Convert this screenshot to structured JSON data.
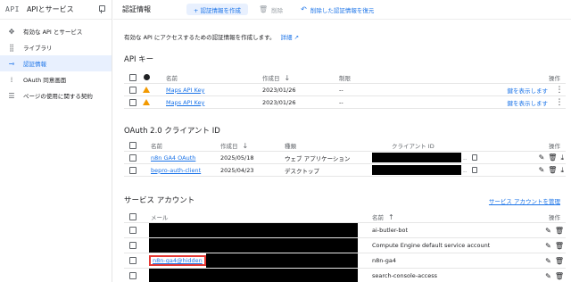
{
  "sidebar": {
    "logo": "API",
    "title": "APIとサービス",
    "items": [
      {
        "label": "有効な API とサービス",
        "icon": "api-services-icon"
      },
      {
        "label": "ライブラリ",
        "icon": "library-icon"
      },
      {
        "label": "認証情報",
        "icon": "key-icon",
        "active": true
      },
      {
        "label": "OAuth 同意画面",
        "icon": "oauth-consent-icon"
      },
      {
        "label": "ページの使用に関する契約",
        "icon": "agreement-icon"
      }
    ]
  },
  "topbar": {
    "title": "認証情報",
    "create_label": "+ 認証情報を作成",
    "delete_label": "削除",
    "restore_label": "削除した認証情報を復元"
  },
  "intro": {
    "text": "有効な API にアクセスするための認証情報を作成します。",
    "link": "詳細"
  },
  "api_keys": {
    "title": "API キー",
    "actions_header": "操作",
    "headers": {
      "name": "名前",
      "created": "作成日",
      "restriction": "制限"
    },
    "rows": [
      {
        "name": "Maps API Key",
        "created": "2023/01/26",
        "restriction": "--",
        "action": "鍵を表示します"
      },
      {
        "name": "Maps API Key",
        "created": "2023/01/26",
        "restriction": "--",
        "action": "鍵を表示します"
      }
    ]
  },
  "oauth": {
    "title": "OAuth 2.0 クライアント ID",
    "actions_header": "操作",
    "headers": {
      "name": "名前",
      "created": "作成日",
      "type": "種類",
      "client_id": "クライアント ID"
    },
    "rows": [
      {
        "name": "n8n GA4 OAuth",
        "created": "2025/05/18",
        "type": "ウェブ アプリケーション"
      },
      {
        "name": "bepro-auth-client",
        "created": "2025/04/23",
        "type": "デスクトップ"
      }
    ]
  },
  "service_accounts": {
    "title": "サービス アカウント",
    "manage_link": "サービス アカウントを管理",
    "actions_header": "操作",
    "headers": {
      "email": "メール",
      "name": "名前"
    },
    "rows": [
      {
        "email": "",
        "name": "ai-butler-bot"
      },
      {
        "email": "",
        "name": "Compute Engine default service account"
      },
      {
        "email": "n8n-ga4@hidden",
        "name": "n8n-ga4"
      },
      {
        "email": "",
        "name": "search-console-access"
      }
    ]
  }
}
